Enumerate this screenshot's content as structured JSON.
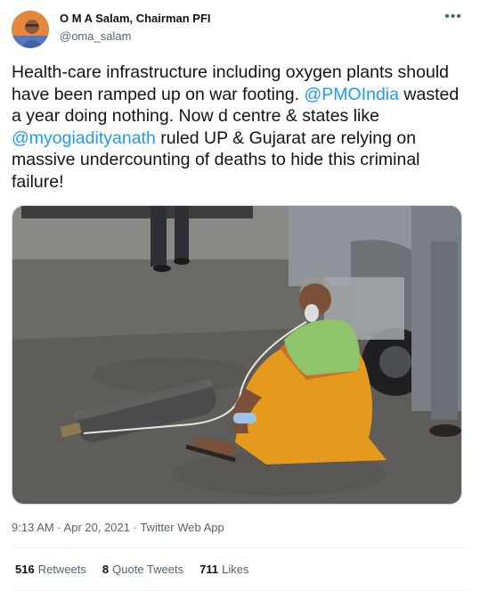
{
  "author": {
    "name": "O M A Salam, Chairman PFI",
    "handle": "@oma_salam"
  },
  "more_label": "•••",
  "tweet": {
    "p1": "Health-care infrastructure including oxygen plants should have been ramped up on war footing. ",
    "m1": "@PMOIndia",
    "p2": " wasted a year doing nothing. Now d centre & states like ",
    "m2": "@myogiadityanath",
    "p3": " ruled UP & Gujarat are relying on massive undercounting of deaths to hide this criminal failure!"
  },
  "meta": {
    "time": "9:13 AM",
    "dot1": " · ",
    "date": "Apr 20, 2021",
    "dot2": " · ",
    "source": "Twitter Web App"
  },
  "stats": {
    "retweets_count": "516",
    "retweets_label": "Retweets",
    "quotes_count": "8",
    "quotes_label": "Quote Tweets",
    "likes_count": "711",
    "likes_label": "Likes"
  },
  "colors": {
    "link": "#1d9bf0",
    "secondary": "#536471",
    "text": "#0f1419"
  }
}
